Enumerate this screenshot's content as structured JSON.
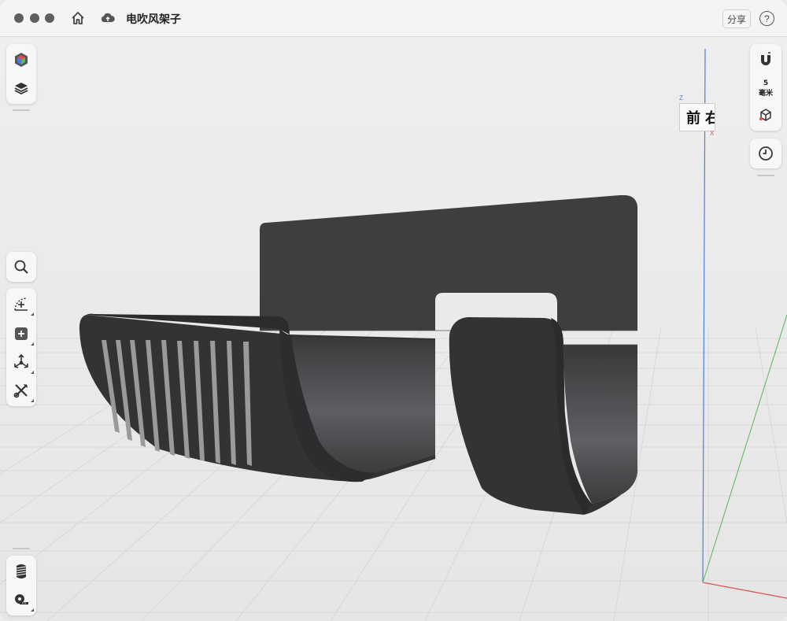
{
  "titlebar": {
    "document_title": "电吹风架子",
    "share_label": "分享",
    "help_label": "?"
  },
  "left_toolbar": {
    "top_items": [
      "appearance-cube-icon",
      "layers-icon"
    ],
    "tools": [
      "search-icon",
      "sketch-icon",
      "add-primitive-icon",
      "transform-icon",
      "modify-tools-icon"
    ],
    "bottom_items": [
      "print-slice-icon",
      "measure-icon"
    ]
  },
  "right_toolbar": {
    "snap_value": "5",
    "snap_unit": "毫米",
    "items": [
      "magnet-snap-icon",
      "snap-cube-icon",
      "history-clock-icon"
    ]
  },
  "viewcube": {
    "front_label": "前",
    "right_label_partial": "右",
    "axis_z": "Z",
    "axis_x": "X"
  },
  "colors": {
    "model": "#3d3d3f",
    "grid_line": "#d2d2d2",
    "axis_blue": "#4a7fe0",
    "axis_red": "#d9534f",
    "axis_green": "#6bbf6b"
  }
}
